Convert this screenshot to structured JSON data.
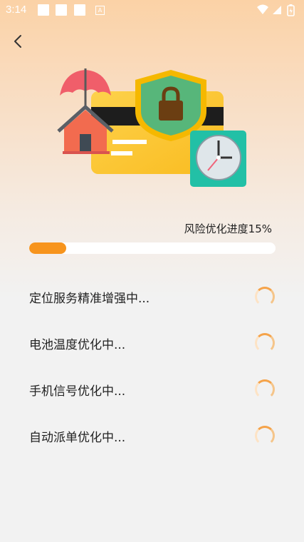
{
  "status_bar": {
    "time": "3:14",
    "notification_letter": "A",
    "icons": [
      "square-notification-icon",
      "square-notification-icon",
      "square-notification-icon",
      "a-notification-icon",
      "wifi-icon",
      "signal-icon",
      "battery-charging-icon"
    ]
  },
  "header": {
    "back_icon": "chevron-left-icon"
  },
  "hero": {
    "illustration": "card-shield-house-clock"
  },
  "progress": {
    "label": "风险优化进度15%",
    "fraction": 0.15,
    "color": "#f7941d"
  },
  "tasks": [
    {
      "label": "定位服务精准增强中..."
    },
    {
      "label": "电池温度优化中..."
    },
    {
      "label": "手机信号优化中..."
    },
    {
      "label": "自动派单优化中..."
    }
  ],
  "colors": {
    "accent": "#f7941d",
    "background": "#f2f2f2"
  }
}
